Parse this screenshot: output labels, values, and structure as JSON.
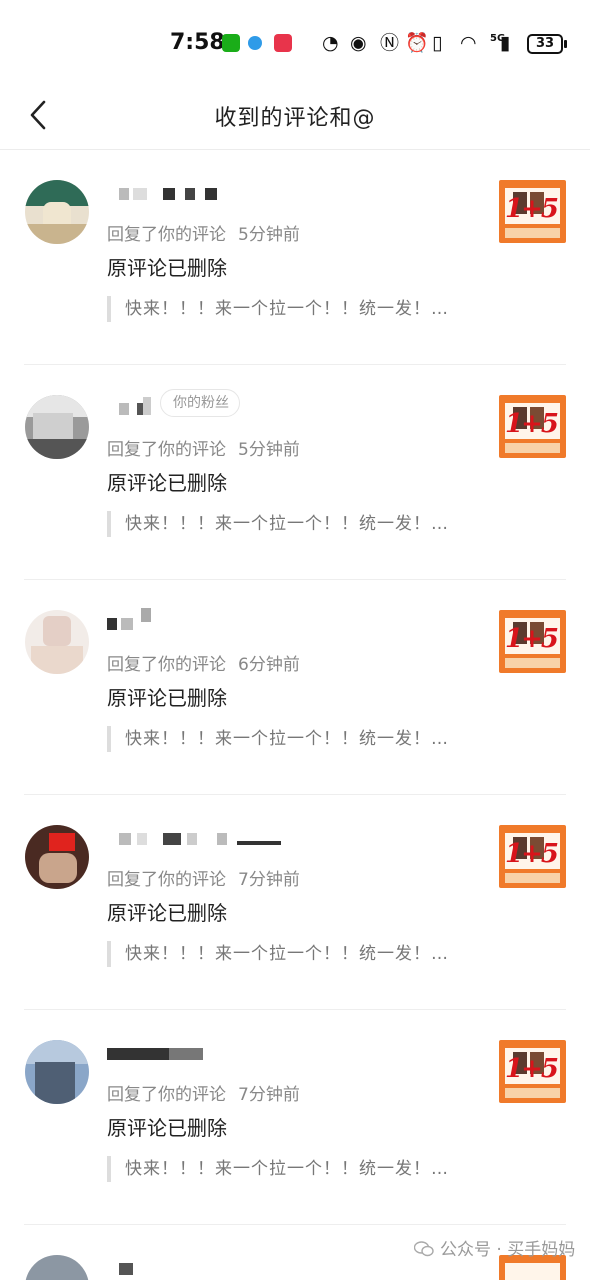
{
  "status_bar": {
    "time": "7:58",
    "network": "5G",
    "battery": "33"
  },
  "header": {
    "title": "收到的评论和@"
  },
  "comments": [
    {
      "fan_tag": "",
      "action": "回复了你的评论",
      "time": "5分钟前",
      "content": "原评论已删除",
      "quote": "快来！！！来一个拉一个！！统一发！…"
    },
    {
      "fan_tag": "你的粉丝",
      "action": "回复了你的评论",
      "time": "5分钟前",
      "content": "原评论已删除",
      "quote": "快来！！！来一个拉一个！！统一发！…"
    },
    {
      "fan_tag": "",
      "action": "回复了你的评论",
      "time": "6分钟前",
      "content": "原评论已删除",
      "quote": "快来！！！来一个拉一个！！统一发！…"
    },
    {
      "fan_tag": "",
      "action": "回复了你的评论",
      "time": "7分钟前",
      "content": "原评论已删除",
      "quote": "快来！！！来一个拉一个！！统一发！…"
    },
    {
      "fan_tag": "",
      "action": "回复了你的评论",
      "time": "7分钟前",
      "content": "原评论已删除",
      "quote": "快来！！！来一个拉一个！！统一发！…"
    }
  ],
  "thumbnail_text": "1+5",
  "watermark": {
    "text": "公众号 · 买手妈妈"
  },
  "colors": {
    "accent": "#f07a2a",
    "thumb_number": "#d8141b"
  }
}
